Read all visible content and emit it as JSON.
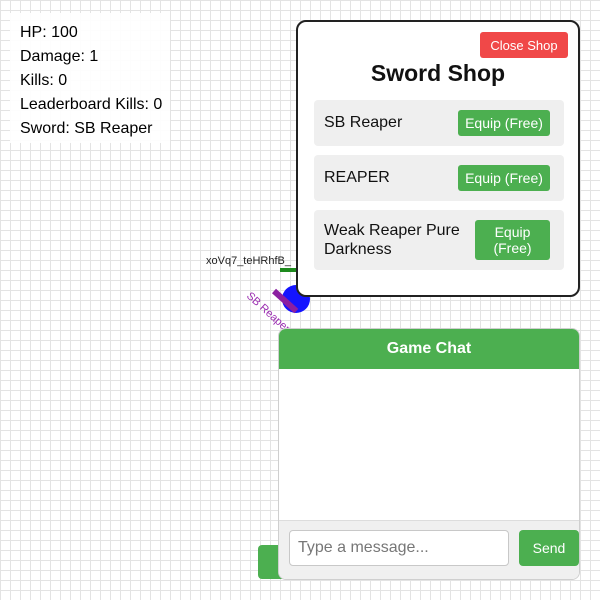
{
  "stats": {
    "hp": "HP: 100",
    "damage": "Damage: 1",
    "kills": "Kills: 0",
    "leaderboard_kills": "Leaderboard Kills: 0",
    "sword": "Sword: SB Reaper"
  },
  "player": {
    "name": "xoVq7_teHRhfB_",
    "sword_label": "SB Reaper",
    "body_color": "#1414ff",
    "sword_color": "#8b1fa0"
  },
  "shop": {
    "title": "Sword Shop",
    "close_label": "Close Shop",
    "items": [
      {
        "name": "SB Reaper",
        "button": "Equip (Free)"
      },
      {
        "name": "REAPER",
        "button": "Equip (Free)"
      },
      {
        "name": "Weak Reaper Pure Darkness",
        "button": "Equip (Free)"
      }
    ]
  },
  "chat": {
    "title": "Game Chat",
    "placeholder": "Type a message...",
    "send_label": "Send"
  },
  "colors": {
    "accent_green": "#4caf50",
    "close_red": "#f04848"
  }
}
